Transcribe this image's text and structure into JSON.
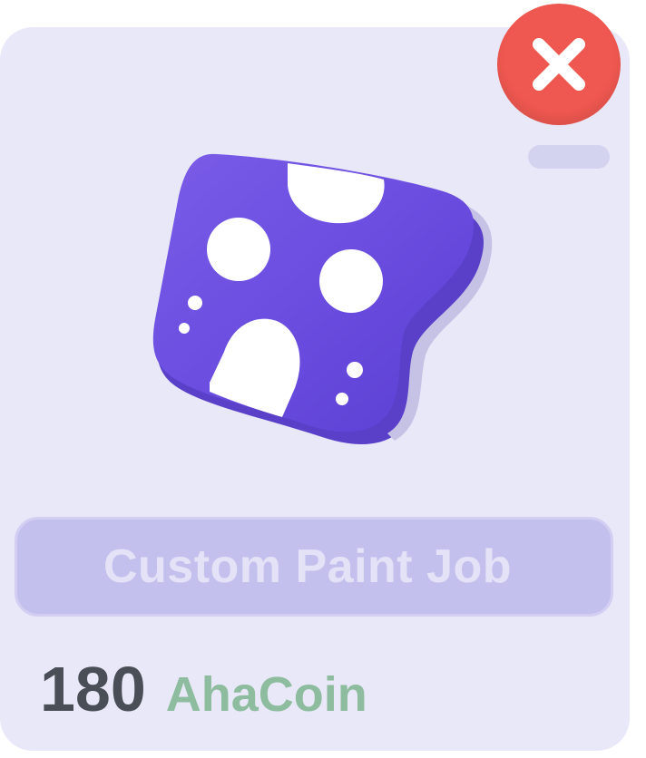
{
  "item": {
    "name": "Custom Paint Job",
    "icon": "custom-paint-job-icon",
    "colors": {
      "primary": "#6d4fe0",
      "highlight": "#8a6cf0",
      "edge": "#b9b5dc"
    }
  },
  "price": {
    "amount": "180",
    "currency": "AhaCoin"
  },
  "close_button": {
    "icon": "close-icon",
    "color": "#ef5850"
  },
  "theme": {
    "card_background": "#e9e8f8",
    "title_bar_background": "#c4c0ee",
    "amount_color": "#4a4e57",
    "currency_color": "#8dbc9e"
  }
}
